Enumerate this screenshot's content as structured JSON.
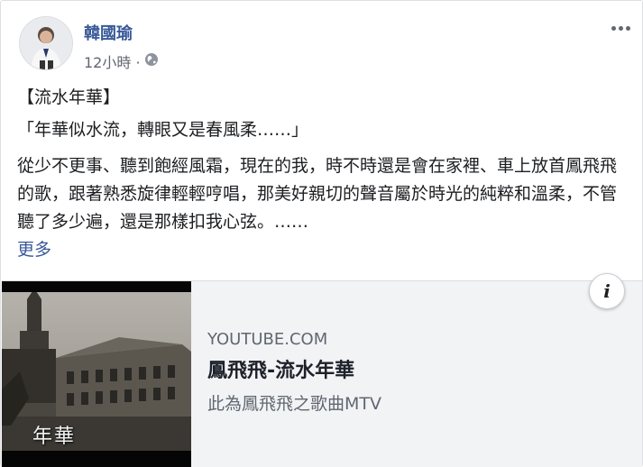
{
  "post": {
    "author": "韓國瑜",
    "timestamp": "12小時 ·",
    "privacy_icon": "globe-icon",
    "paragraphs": {
      "title": "【流水年華】",
      "quote": "「年華似水流，轉眼又是春風柔……」",
      "body": "從少不更事、聽到飽經風霜，現在的我，時不時還是會在家裡、車上放首鳳飛飛的歌，跟著熟悉旋律輕輕哼唱，那美好親切的聲音屬於時光的純粹和溫柔，不管聽了多少遍，還是那樣扣我心弦。……",
      "see_more": "更多"
    }
  },
  "link_card": {
    "domain": "YOUTUBE.COM",
    "title": "鳳飛飛-流水年華",
    "description": "此為鳳飛飛之歌曲MTV",
    "thumbnail_caption": "年華"
  },
  "colors": {
    "link": "#385898",
    "meta": "#616770",
    "card_bg": "#f2f3f5"
  }
}
